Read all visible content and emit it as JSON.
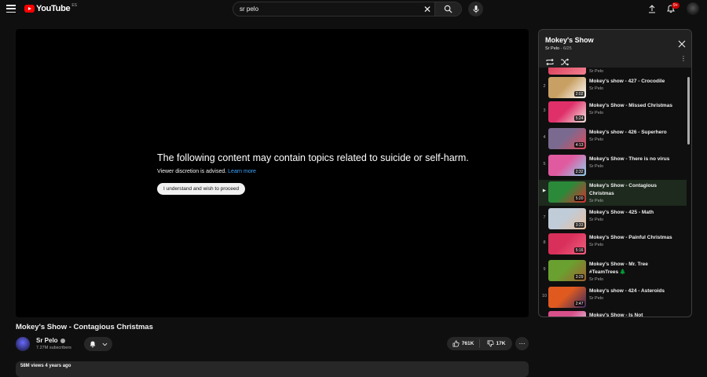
{
  "header": {
    "logo_text": "YouTube",
    "logo_country": "ES",
    "search_value": "sr pelo",
    "notification_count": "9+"
  },
  "player": {
    "warning_title": "The following content may contain topics related to suicide or self-harm.",
    "warning_sub": "Viewer discretion is advised.",
    "learn_more": "Learn more",
    "proceed_label": "I understand and wish to proceed"
  },
  "video": {
    "title": "Mokey's Show - Contagious Christmas",
    "channel": "Sr Pelo",
    "subscribers": "7.27M subscribers",
    "likes": "761K",
    "dislikes": "17K",
    "description_preview": "58M views  4 years ago"
  },
  "playlist": {
    "title": "Mokey's Show",
    "owner": "Sr Pelo",
    "position": "6/25",
    "top_partial_channel": "Sr Pelo",
    "items": [
      {
        "index": "2",
        "title": "Mokey's show - 427 - Crocodile",
        "channel": "Sr Pelo",
        "duration": "2:02",
        "color1": "#c9a064",
        "color2": "#ffffff"
      },
      {
        "index": "3",
        "title": "Mokey's Show - Missed Christmas",
        "channel": "Sr Pelo",
        "duration": "5:24",
        "color1": "#e0306a",
        "color2": "#f0e6e0"
      },
      {
        "index": "4",
        "title": "Mokey's show - 426 - Superhero",
        "channel": "Sr Pelo",
        "duration": "4:13",
        "color1": "#7a6a90",
        "color2": "#e04a5a"
      },
      {
        "index": "5",
        "title": "Mokey's Show - There is no virus",
        "channel": "Sr Pelo",
        "duration": "2:32",
        "color1": "#e05aa0",
        "color2": "#8fd0ef"
      },
      {
        "index": "▶",
        "title": "Mokey's Show - Contagious Christmas",
        "channel": "Sr Pelo",
        "duration": "5:20",
        "color1": "#2a8a3a",
        "color2": "#d83030"
      },
      {
        "index": "7",
        "title": "Mokey's Show - 425 - Math",
        "channel": "Sr Pelo",
        "duration": "3:33",
        "color1": "#c0ccd8",
        "color2": "#e8c0a0"
      },
      {
        "index": "8",
        "title": "Mokey's Show - Painful Christmas",
        "channel": "Sr Pelo",
        "duration": "5:16",
        "color1": "#d8305a",
        "color2": "#f06080"
      },
      {
        "index": "9",
        "title": "Mokey's Show - Mr. Tree #TeamTrees 🌲",
        "channel": "Sr Pelo",
        "duration": "3:29",
        "color1": "#6aa030",
        "color2": "#a06030"
      },
      {
        "index": "10",
        "title": "Mokey's show - 424 - Asteroids",
        "channel": "Sr Pelo",
        "duration": "2:47",
        "color1": "#e05a20",
        "color2": "#3a2a60"
      },
      {
        "index": "",
        "title": "Mokey's Show - Is Not",
        "channel": "",
        "duration": "",
        "color1": "#d8508a",
        "color2": "#e0e0f0"
      }
    ]
  },
  "colors": {
    "background": "#0f0f0f",
    "accent_red": "#ff0000",
    "link_blue": "#3ea6ff",
    "active_row": "#1d2a1d"
  },
  "icons": {
    "menu": "menu-icon",
    "search": "search-icon",
    "clear": "close-icon",
    "mic": "microphone-icon",
    "upload": "upload-icon",
    "bell": "bell-icon",
    "like": "thumbs-up-icon",
    "dislike": "thumbs-down-icon",
    "loop": "loop-icon",
    "shuffle": "shuffle-icon"
  }
}
